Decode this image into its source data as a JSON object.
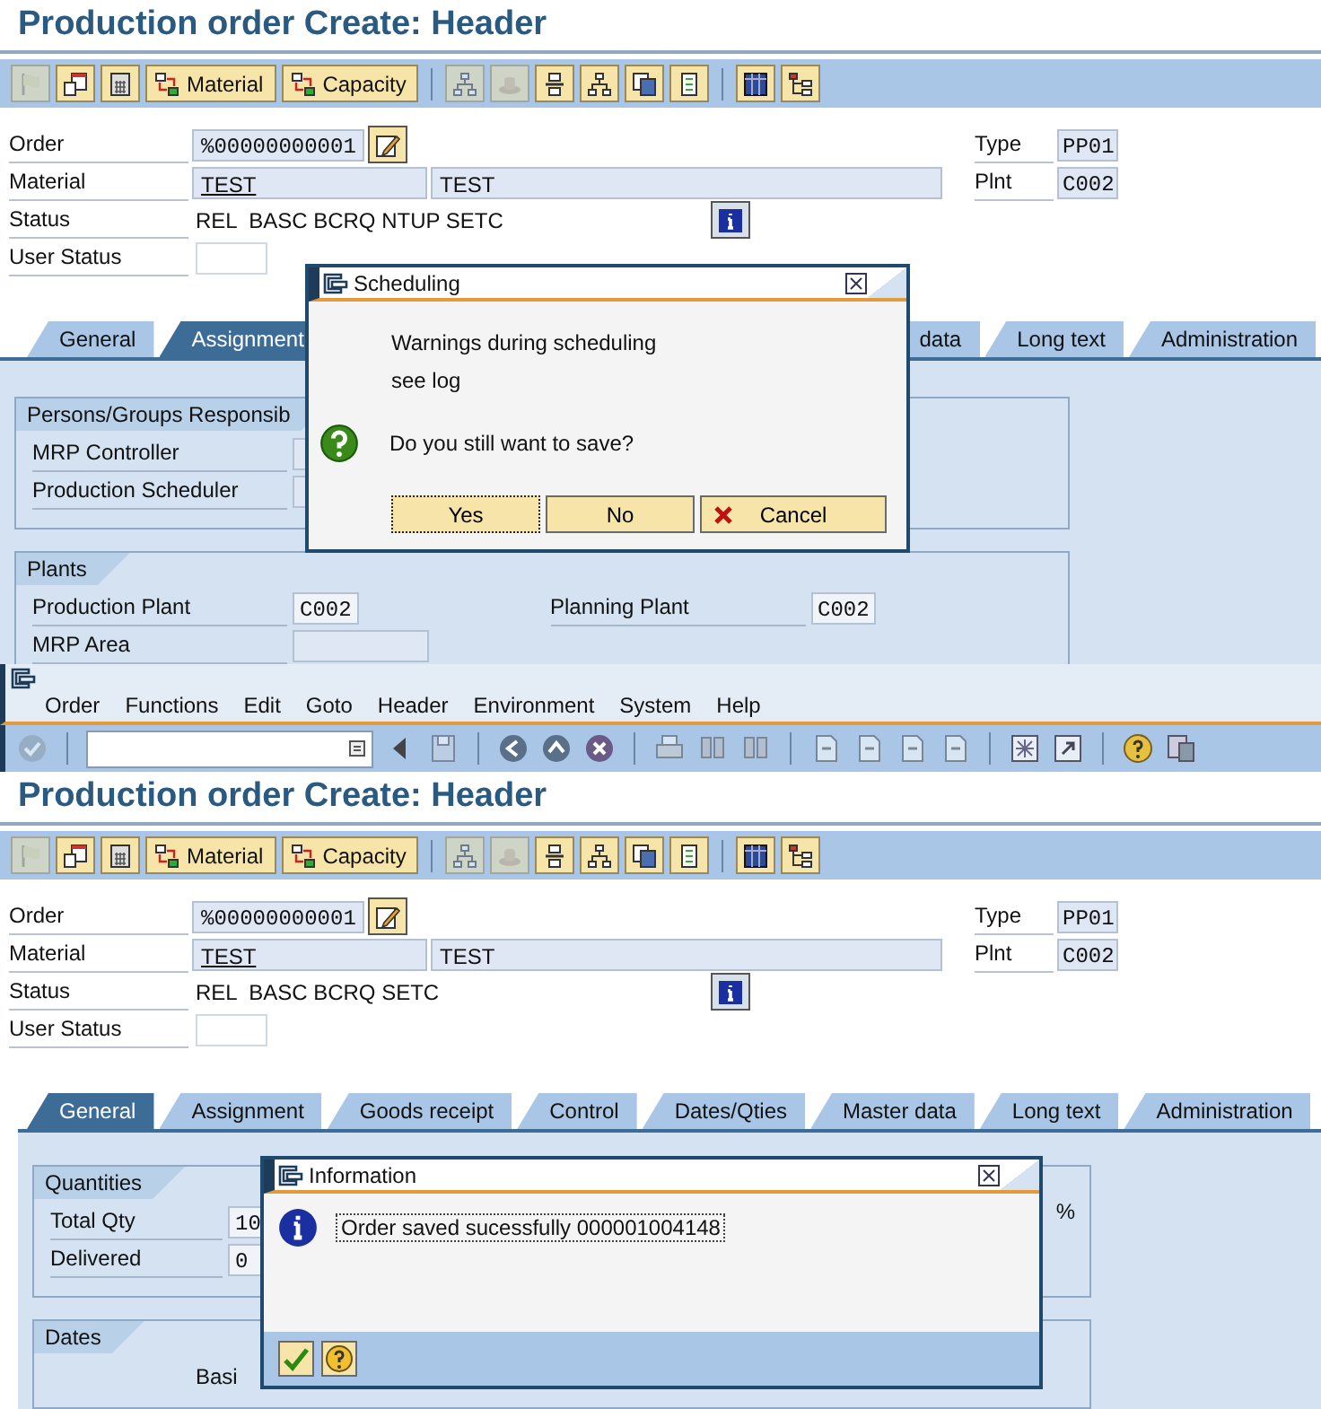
{
  "screens": [
    {
      "title": "Production order Create: Header",
      "toolbar": [
        {
          "items": [
            {
              "kind": "icon",
              "disabled": true
            },
            {
              "kind": "icon",
              "disabled": false
            },
            {
              "kind": "icon",
              "disabled": false
            },
            {
              "kind": "text",
              "label": "Material",
              "disabled": false
            },
            {
              "kind": "text",
              "label": "Capacity",
              "disabled": false
            }
          ]
        },
        {
          "items": [
            {
              "kind": "icon",
              "disabled": true
            },
            {
              "kind": "icon",
              "disabled": true
            },
            {
              "kind": "icon",
              "disabled": false
            },
            {
              "kind": "icon",
              "disabled": false
            },
            {
              "kind": "icon",
              "disabled": false
            },
            {
              "kind": "icon",
              "disabled": false
            }
          ]
        },
        {
          "items": [
            {
              "kind": "icon",
              "disabled": false
            },
            {
              "kind": "icon",
              "disabled": false
            }
          ]
        }
      ],
      "header": {
        "order_label": "Order",
        "order": "%00000000001",
        "type_label": "Type",
        "type": "PP01",
        "material_label": "Material",
        "material": "TEST",
        "material_text": "TEST",
        "plnt_label": "Plnt",
        "plnt": "C002",
        "status_label": "Status",
        "status": "REL  BASC BCRQ NTUP SETC",
        "user_status_label": "User Status"
      },
      "tabs": [
        {
          "label": "General",
          "selected": false
        },
        {
          "label": "Assignment",
          "selected": true
        },
        {
          "label": "data",
          "selected": false
        },
        {
          "label": "Long text",
          "selected": false
        },
        {
          "label": "Administration",
          "selected": false
        }
      ],
      "sections": [
        {
          "title": "Persons/Groups Responsib",
          "rows": [
            [
              {
                "label": "MRP Controller"
              }
            ],
            [
              {
                "label": "Production Scheduler"
              }
            ]
          ]
        },
        {
          "title": "Plants",
          "rows": [
            [
              {
                "label": "Production Plant",
                "value": "C002"
              },
              {
                "label": "Planning Plant",
                "value": "C002"
              }
            ],
            [
              {
                "label": "MRP Area"
              }
            ]
          ]
        }
      ],
      "dialog": {
        "kind": "question",
        "title": "Scheduling",
        "messages": [
          "Warnings during scheduling",
          "see log"
        ],
        "question": "Do you still want to save?",
        "buttons": [
          {
            "kind": "plain",
            "label": "Yes",
            "focused": true
          },
          {
            "kind": "plain",
            "label": "No",
            "focused": false
          },
          {
            "kind": "cancel",
            "label": "Cancel",
            "focused": false
          }
        ]
      }
    },
    {
      "menu": [
        "Order",
        "Functions",
        "Edit",
        "Goto",
        "Header",
        "Environment",
        "System",
        "Help"
      ],
      "system_toolbar": [
        [
          {
            "disabled": true
          }
        ],
        [
          {
            "disabled": false
          },
          {
            "disabled": true
          }
        ],
        [
          {
            "disabled": false
          },
          {
            "disabled": false
          },
          {
            "disabled": false
          }
        ],
        [
          {
            "disabled": true
          },
          {
            "disabled": true
          },
          {
            "disabled": true
          }
        ],
        [
          {
            "disabled": true
          },
          {
            "disabled": true
          },
          {
            "disabled": true
          },
          {
            "disabled": true
          }
        ],
        [
          {
            "disabled": false
          },
          {
            "disabled": false
          }
        ],
        [
          {
            "disabled": false
          },
          {
            "disabled": false
          }
        ]
      ],
      "title": "Production order Create: Header",
      "toolbar": [
        {
          "items": [
            {
              "kind": "icon",
              "disabled": true
            },
            {
              "kind": "icon",
              "disabled": false
            },
            {
              "kind": "icon",
              "disabled": false
            },
            {
              "kind": "text",
              "label": "Material",
              "disabled": false
            },
            {
              "kind": "text",
              "label": "Capacity",
              "disabled": false
            }
          ]
        },
        {
          "items": [
            {
              "kind": "icon",
              "disabled": true
            },
            {
              "kind": "icon",
              "disabled": true
            },
            {
              "kind": "icon",
              "disabled": false
            },
            {
              "kind": "icon",
              "disabled": false
            },
            {
              "kind": "icon",
              "disabled": false
            },
            {
              "kind": "icon",
              "disabled": false
            }
          ]
        },
        {
          "items": [
            {
              "kind": "icon",
              "disabled": false
            },
            {
              "kind": "icon",
              "disabled": false
            }
          ]
        }
      ],
      "header": {
        "order_label": "Order",
        "order": "%00000000001",
        "type_label": "Type",
        "type": "PP01",
        "material_label": "Material",
        "material": "TEST",
        "material_text": "TEST",
        "plnt_label": "Plnt",
        "plnt": "C002",
        "status_label": "Status",
        "status": "REL  BASC BCRQ SETC",
        "user_status_label": "User Status"
      },
      "tabs": [
        {
          "label": "General",
          "selected": true
        },
        {
          "label": "Assignment",
          "selected": false
        },
        {
          "label": "Goods receipt",
          "selected": false
        },
        {
          "label": "Control",
          "selected": false
        },
        {
          "label": "Dates/Qties",
          "selected": false
        },
        {
          "label": "Master data",
          "selected": false
        },
        {
          "label": "Long text",
          "selected": false
        },
        {
          "label": "Administration",
          "selected": false
        }
      ],
      "sections": [
        {
          "title": "Quantities",
          "note": "%",
          "rows": [
            [
              {
                "label": "Total Qty",
                "value": "10"
              }
            ],
            [
              {
                "label": "Delivered",
                "value": "0"
              }
            ]
          ]
        },
        {
          "title": "Dates",
          "caption": "Basi"
        }
      ],
      "dialog": {
        "kind": "info",
        "title": "Information",
        "message": "Order saved sucessfully 000001004148",
        "buttons": [
          {
            "kind": "confirm"
          },
          {
            "kind": "help"
          }
        ]
      }
    }
  ]
}
